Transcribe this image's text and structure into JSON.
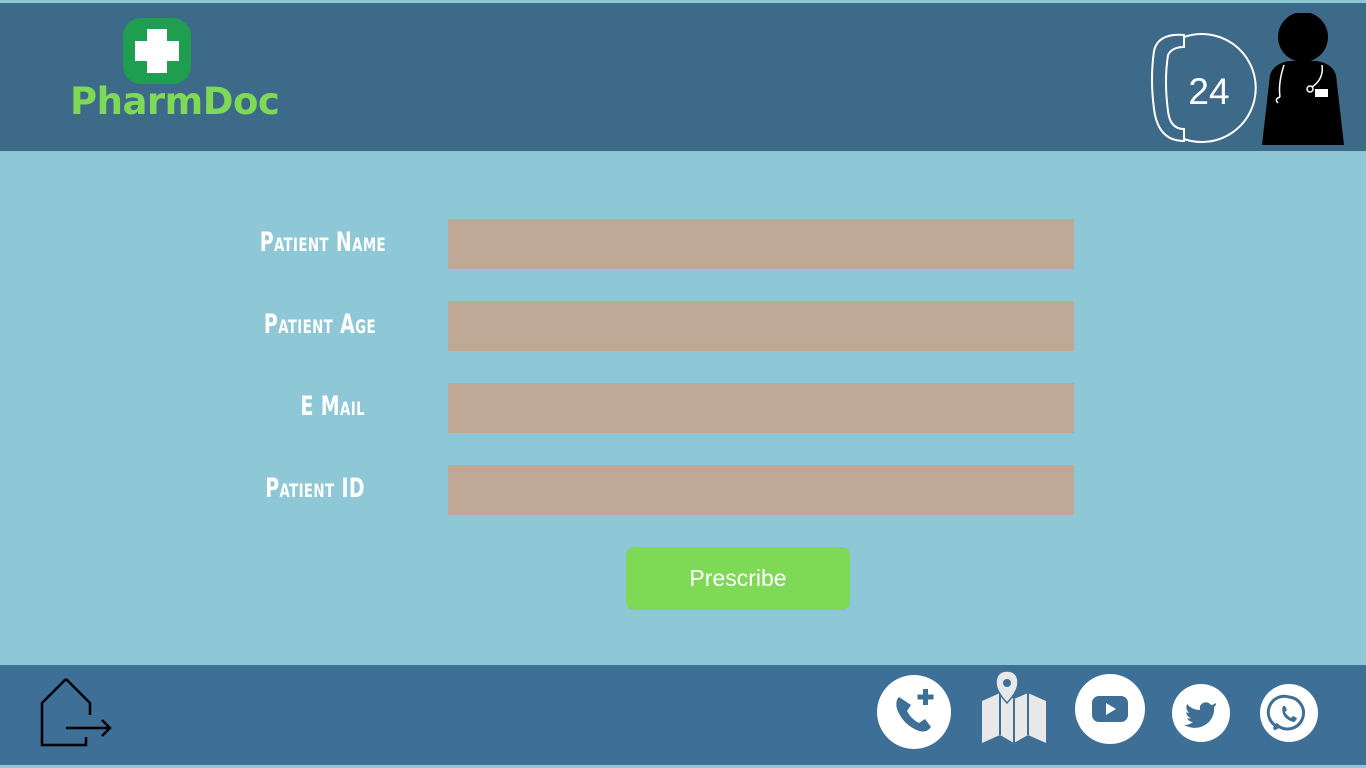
{
  "header": {
    "brand_name": "PharmDoc",
    "support_hours": "24",
    "logo_icon": "medical-cross-icon",
    "support_icon": "24-hour-phone-icon",
    "profile_icon": "doctor-avatar-icon"
  },
  "form": {
    "fields": [
      {
        "label": "Patient Name",
        "value": ""
      },
      {
        "label": "Patient Age",
        "value": ""
      },
      {
        "label": "E Mail",
        "value": ""
      },
      {
        "label": "Patient ID",
        "value": ""
      }
    ],
    "submit_label": "Prescribe"
  },
  "footer": {
    "icons": [
      "logout-icon",
      "call-doctor-icon",
      "map-location-icon",
      "youtube-icon",
      "twitter-icon",
      "whatsapp-icon"
    ]
  },
  "colors": {
    "header_bg": "#3e6a89",
    "page_bg": "#8ec7d6",
    "footer_bg": "#3e6f96",
    "brand_green": "#7ed957",
    "logo_green": "#1f9e4f",
    "input_bg": "#c0a896",
    "button_bg": "#7ed957"
  }
}
